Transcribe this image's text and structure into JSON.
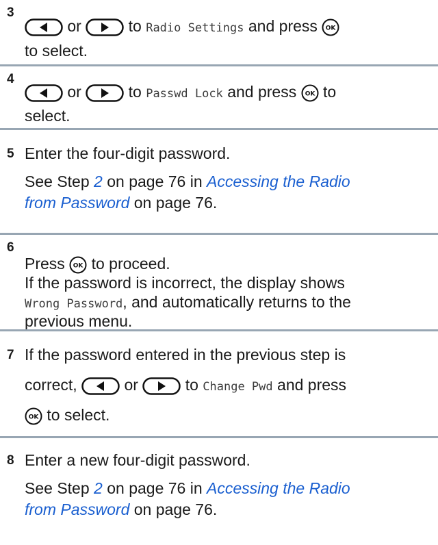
{
  "steps": [
    {
      "num": "3",
      "l1": [
        "or",
        "to",
        "Radio Settings",
        "and press"
      ],
      "l2": "to select."
    },
    {
      "num": "4",
      "l1": [
        "or",
        "to",
        "Passwd Lock",
        "and press",
        "to"
      ],
      "l2": "select."
    },
    {
      "num": "5",
      "l1": "Enter the four-digit password.",
      "l2": [
        "See Step",
        "2",
        "on page 76 in",
        "Accessing the Radio"
      ],
      "l3": [
        "from Password",
        "on page 76."
      ]
    },
    {
      "num": "6",
      "l1": [
        "Press",
        "to proceed."
      ],
      "l2": "If the password is incorrect, the display shows",
      "l3": [
        "Wrong Password",
        ", and automatically returns to the"
      ],
      "l4": "previous menu."
    },
    {
      "num": "7",
      "l1": "If the password entered in the previous step is",
      "l2": [
        "correct,",
        "or",
        "to",
        "Change Pwd",
        "and press"
      ],
      "l3": "to select."
    },
    {
      "num": "8",
      "l1": "Enter a new four-digit password.",
      "l2": [
        "See Step",
        "2",
        "on page 76 in",
        "Accessing the Radio"
      ],
      "l3": [
        "from Password",
        "on page 76."
      ]
    }
  ],
  "icons": {
    "left": "left-arrow-button-icon",
    "right": "right-arrow-button-icon",
    "ok": "ok-button-icon"
  }
}
